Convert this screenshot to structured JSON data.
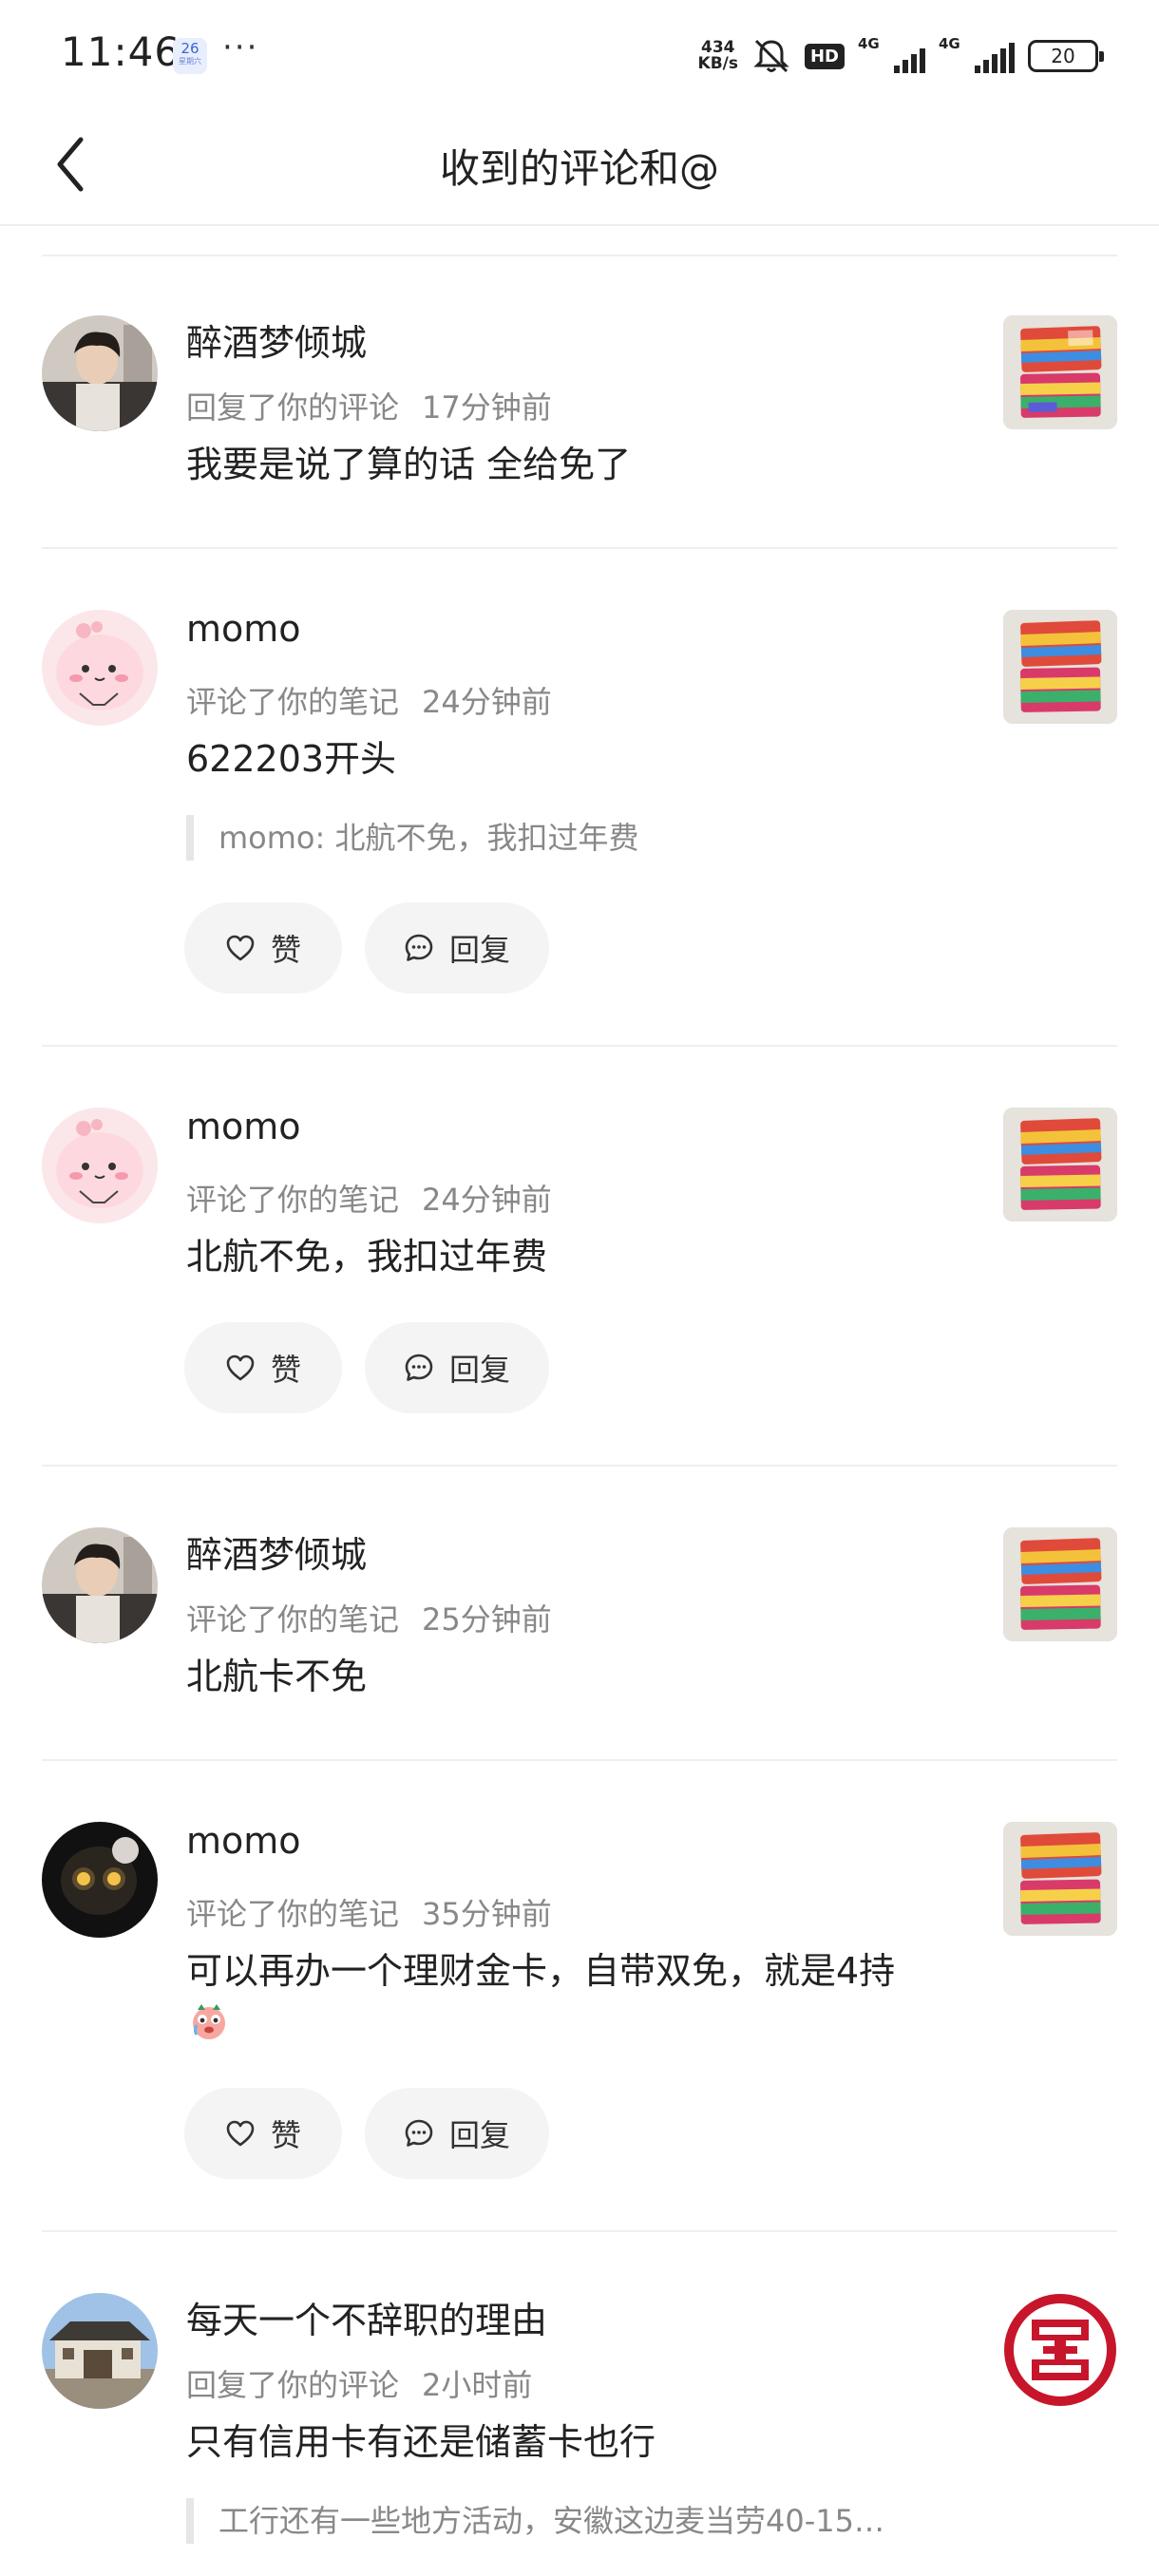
{
  "status_bar": {
    "time": "11:46",
    "calendar_day": "26",
    "calendar_sub": "星期六",
    "more": "···",
    "net_speed_value": "434",
    "net_speed_unit": "KB/s",
    "hd": "HD",
    "signal1": "4G",
    "signal2": "4G",
    "battery": "20"
  },
  "nav": {
    "title": "收到的评论和@"
  },
  "actions": {
    "like": "赞",
    "reply": "回复"
  },
  "items": [
    {
      "user": "醉酒梦倾城",
      "action": "回复了你的评论",
      "time": "17分钟前",
      "content": "我要是说了算的话 全给免了",
      "quote": "",
      "has_buttons": false,
      "avatar": "person-photo",
      "thumb": "card-photo"
    },
    {
      "user": "momo",
      "action": "评论了你的笔记",
      "time": "24分钟前",
      "content": "622203开头",
      "quote": "momo: 北航不免，我扣过年费",
      "has_buttons": true,
      "avatar": "pink-cartoon",
      "thumb": "card-photo"
    },
    {
      "user": "momo",
      "action": "评论了你的笔记",
      "time": "24分钟前",
      "content": "北航不免，我扣过年费",
      "quote": "",
      "has_buttons": true,
      "avatar": "pink-cartoon",
      "thumb": "card-photo"
    },
    {
      "user": "醉酒梦倾城",
      "action": "评论了你的笔记",
      "time": "25分钟前",
      "content": "北航卡不免",
      "quote": "",
      "has_buttons": false,
      "avatar": "person-photo",
      "thumb": "card-photo"
    },
    {
      "user": "momo",
      "action": "评论了你的笔记",
      "time": "35分钟前",
      "content": "可以再办一个理财金卡，自带双免，就是4持",
      "quote": "",
      "has_buttons": true,
      "avatar": "dark-cartoon",
      "thumb": "card-photo"
    },
    {
      "user": "每天一个不辞职的理由",
      "action": "回复了你的评论",
      "time": "2小时前",
      "content": "只有信用卡有还是储蓄卡也行",
      "quote": "工行还有一些地方活动，安徽这边麦当劳40-15…",
      "has_buttons": false,
      "avatar": "building-photo",
      "thumb": "icbc-logo"
    }
  ],
  "colors": {
    "icbc_red": "#c7162b",
    "meta_gray": "#888888",
    "button_bg": "#f4f4f4"
  }
}
